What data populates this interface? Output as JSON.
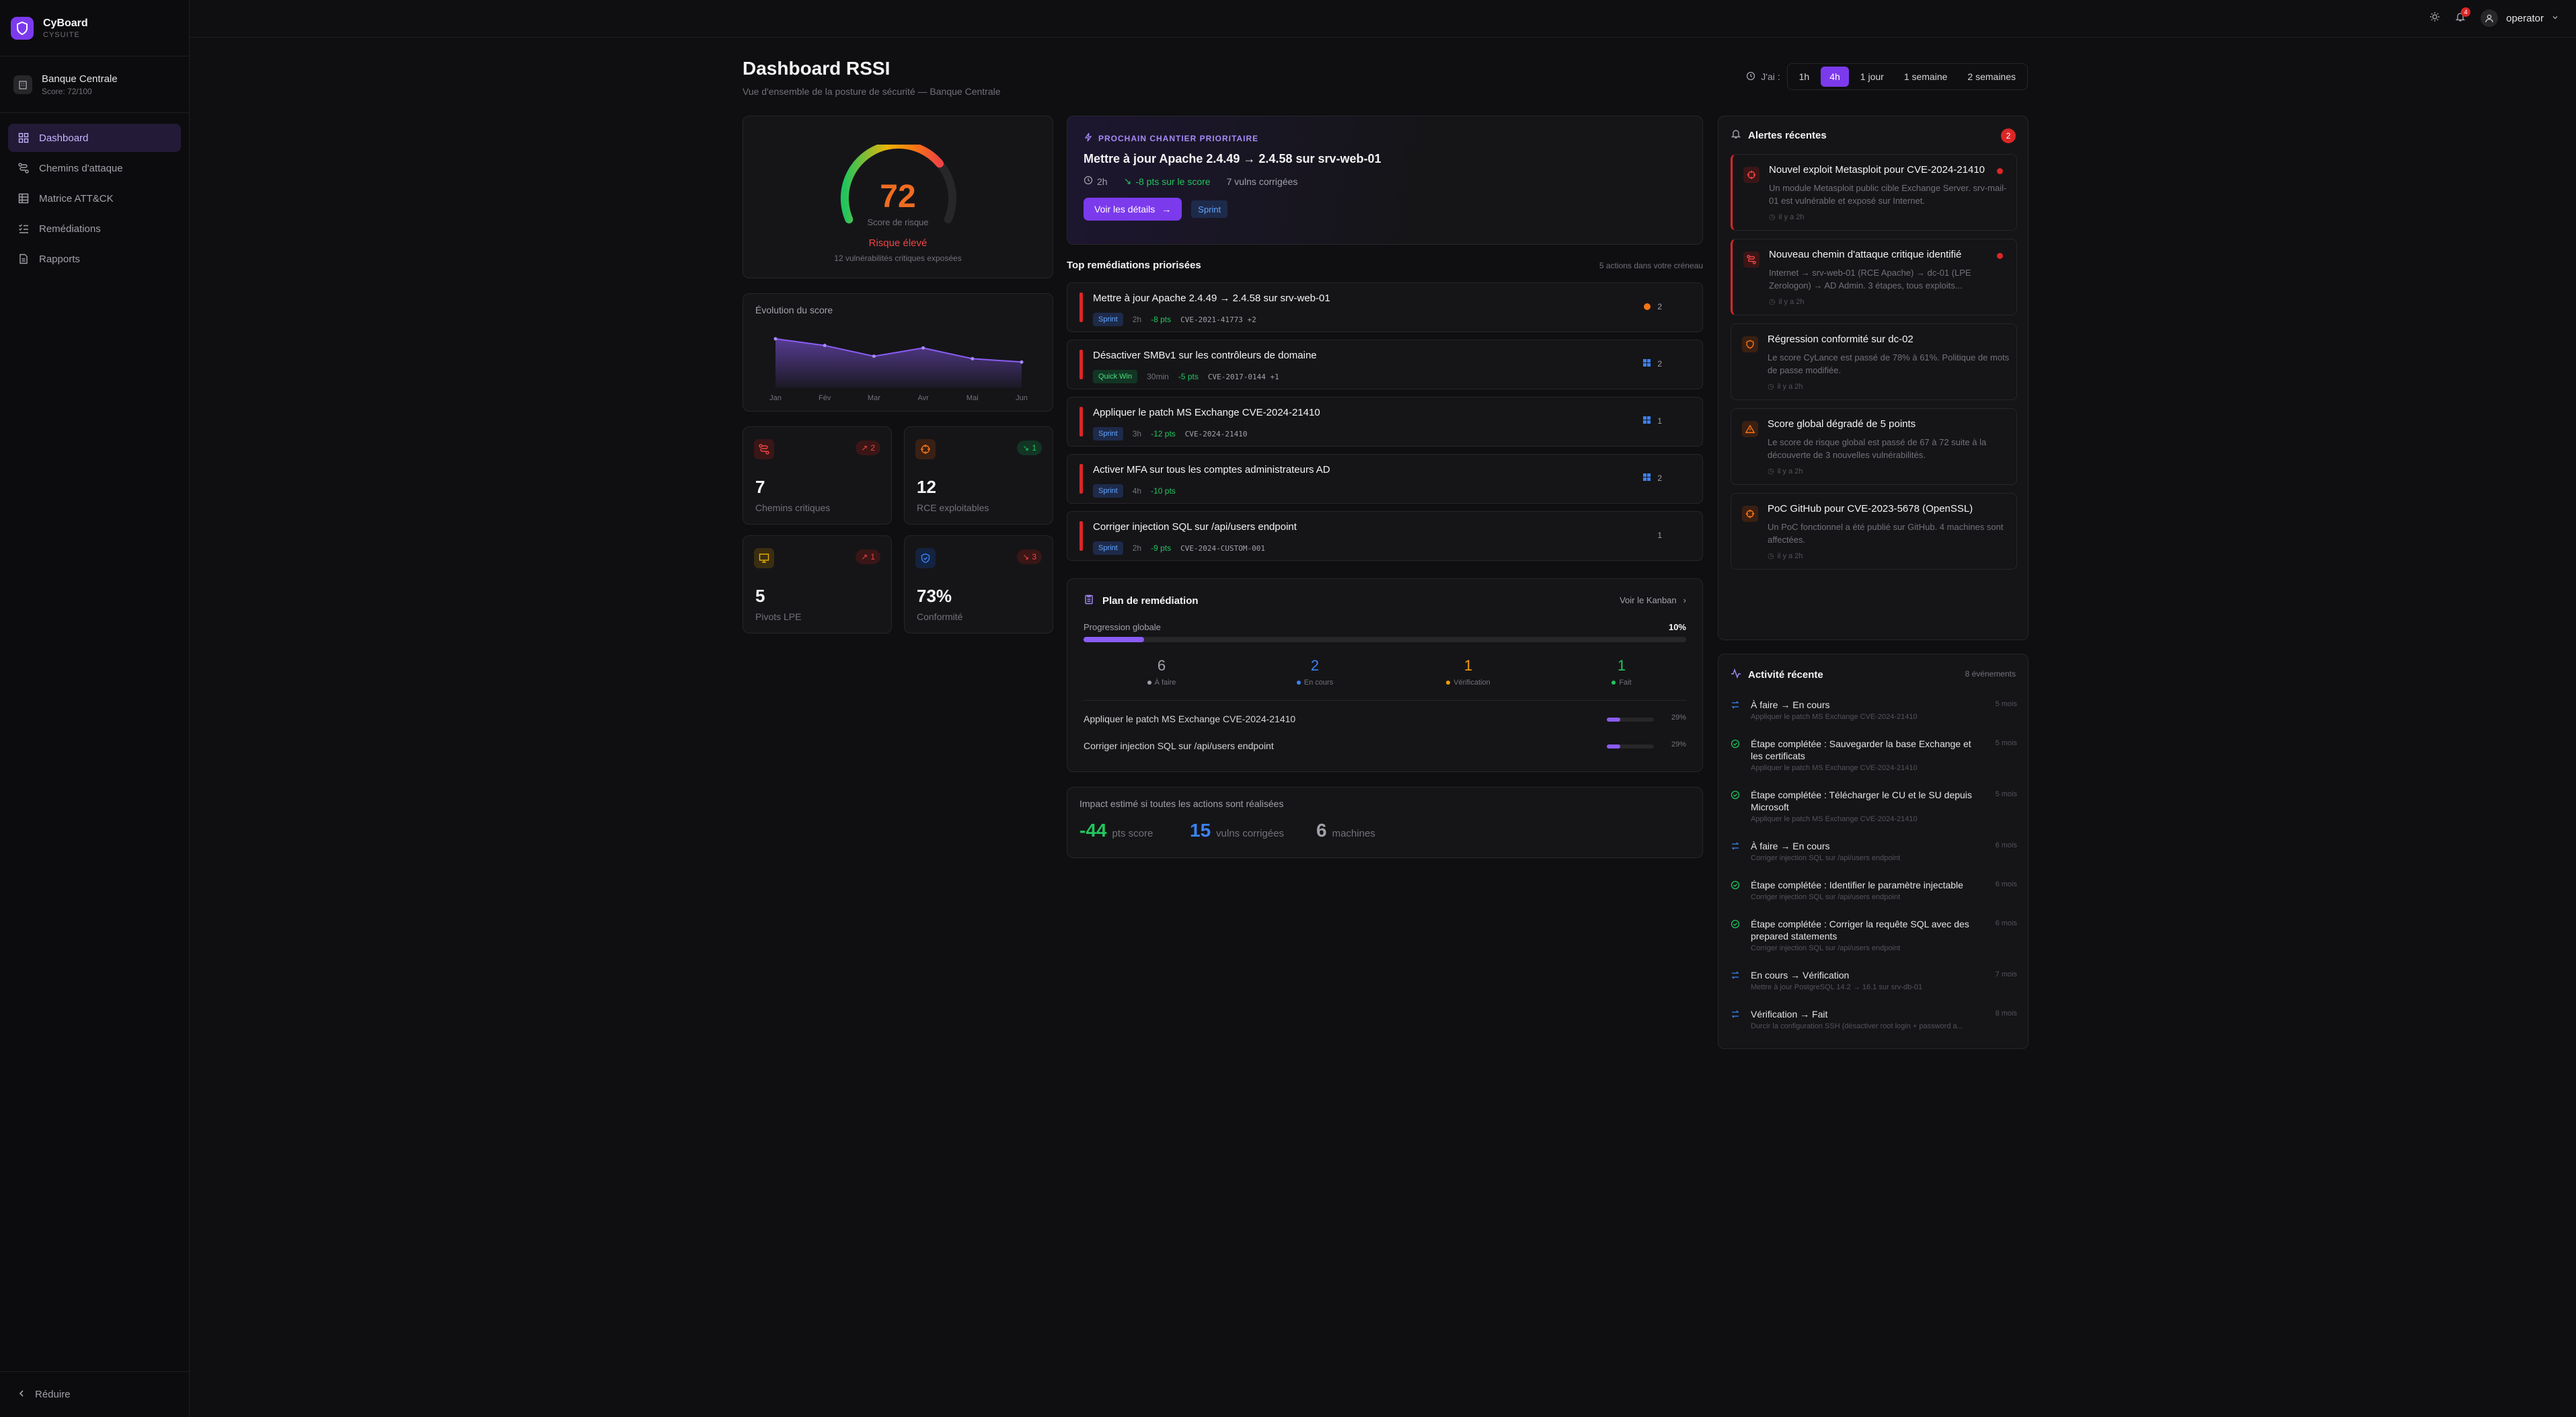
{
  "app": {
    "name": "CyBoard",
    "suite": "CYSUITE"
  },
  "org": {
    "name": "Banque Centrale",
    "score": "Score: 72/100"
  },
  "nav": [
    {
      "label": "Dashboard",
      "icon": "grid-icon"
    },
    {
      "label": "Chemins d'attaque",
      "icon": "route-icon"
    },
    {
      "label": "Matrice ATT&CK",
      "icon": "table-icon"
    },
    {
      "label": "Remédiations",
      "icon": "list-check-icon"
    },
    {
      "label": "Rapports",
      "icon": "document-icon"
    }
  ],
  "collapse_label": "Réduire",
  "topbar": {
    "notification_count": "4",
    "user": "operator"
  },
  "page": {
    "title": "Dashboard RSSI",
    "subtitle": "Vue d'ensemble de la posture de sécurité — Banque Centrale"
  },
  "time_range": {
    "label": "J'ai :",
    "options": [
      "1h",
      "4h",
      "1 jour",
      "1 semaine",
      "2 semaines"
    ],
    "selected": "4h"
  },
  "risk": {
    "score": "72",
    "score_value": 72,
    "caption": "Score de risque",
    "level": "Risque élevé",
    "detail": "12 vulnérabilités critiques exposées"
  },
  "chart_data": {
    "type": "area",
    "title": "Évolution du score",
    "categories": [
      "Jan",
      "Fév",
      "Mar",
      "Avr",
      "Mai",
      "Jun"
    ],
    "values": [
      88,
      80,
      67,
      77,
      64,
      60
    ],
    "ylim": [
      40,
      100
    ]
  },
  "stats": [
    {
      "value": "7",
      "label": "Chemins critiques",
      "badge": "2",
      "trend": "up-bad",
      "icon": "route-icon",
      "color": "#ef4444"
    },
    {
      "value": "12",
      "label": "RCE exploitables",
      "badge": "1",
      "trend": "down-good",
      "icon": "target-icon",
      "color": "#f97316"
    },
    {
      "value": "5",
      "label": "Pivots LPE",
      "badge": "1",
      "trend": "up-bad",
      "icon": "monitor-icon",
      "color": "#eab308"
    },
    {
      "value": "73%",
      "label": "Conformité",
      "badge": "3",
      "trend": "down-bad",
      "icon": "shield-check-icon",
      "color": "#3b82f6"
    }
  ],
  "priority": {
    "eyebrow": "PROCHAIN CHANTIER PRIORITAIRE",
    "title": "Mettre à jour Apache 2.4.49 → 2.4.58 sur srv-web-01",
    "duration": "2h",
    "gain": "-8 pts sur le score",
    "vulns": "7 vulns corrigées",
    "button": "Voir les détails",
    "tag": "Sprint"
  },
  "remediations": {
    "title": "Top remédiations priorisées",
    "note": "5 actions dans votre créneau",
    "items": [
      {
        "title": "Mettre à jour Apache 2.4.49 → 2.4.58 sur srv-web-01",
        "tag": "Sprint",
        "time": "2h",
        "pts": "-8 pts",
        "cve": "CVE-2021-41773 +2",
        "count": "2",
        "dot": "#f97316"
      },
      {
        "title": "Désactiver SMBv1 sur les contrôleurs de domaine",
        "tag": "Quick Win",
        "time": "30min",
        "pts": "-5 pts",
        "cve": "CVE-2017-0144 +1",
        "count": "2",
        "dot": "#3b82f6"
      },
      {
        "title": "Appliquer le patch MS Exchange CVE-2024-21410",
        "tag": "Sprint",
        "time": "3h",
        "pts": "-12 pts",
        "cve": "CVE-2024-21410",
        "count": "1",
        "dot": "#3b82f6"
      },
      {
        "title": "Activer MFA sur tous les comptes administrateurs AD",
        "tag": "Sprint",
        "time": "4h",
        "pts": "-10 pts",
        "cve": "",
        "count": "2",
        "dot": "#3b82f6"
      },
      {
        "title": "Corriger injection SQL sur /api/users endpoint",
        "tag": "Sprint",
        "time": "2h",
        "pts": "-9 pts",
        "cve": "CVE-2024-CUSTOM-001",
        "count": "1",
        "dot": ""
      }
    ]
  },
  "plan": {
    "title": "Plan de remédiation",
    "kanban": "Voir le Kanban",
    "progress_label": "Progression globale",
    "progress": "10%",
    "progress_value": 0.1,
    "columns": [
      {
        "num": "6",
        "label": "À faire",
        "color": "#a1a1aa"
      },
      {
        "num": "2",
        "label": "En cours",
        "color": "#3b82f6"
      },
      {
        "num": "1",
        "label": "Vérification",
        "color": "#f59e0b"
      },
      {
        "num": "1",
        "label": "Fait",
        "color": "#22c55e"
      }
    ],
    "tasks": [
      {
        "title": "Appliquer le patch MS Exchange CVE-2024-21410",
        "pct": "29%",
        "value": 0.29
      },
      {
        "title": "Corriger injection SQL sur /api/users endpoint",
        "pct": "29%",
        "value": 0.29
      }
    ]
  },
  "impact": {
    "title": "Impact estimé si toutes les actions sont réalisées",
    "pts": "-44",
    "pts_unit": "pts score",
    "vulns": "15",
    "vulns_unit": "vulns corrigées",
    "machines": "6",
    "machines_unit": "machines"
  },
  "alerts": {
    "title": "Alertes récentes",
    "count": "2",
    "items": [
      {
        "title": "Nouvel exploit Metasploit pour CVE-2024-21410",
        "desc": "Un module Metasploit public cible Exchange Server. srv-mail-01 est vulnérable et exposé sur Internet.",
        "time": "il y a 2h",
        "critical": true,
        "icon": "target-icon",
        "color": "#ef4444"
      },
      {
        "title": "Nouveau chemin d'attaque critique identifié",
        "desc": "Internet → srv-web-01 (RCE Apache) → dc-01 (LPE Zerologon) → AD Admin. 3 étapes, tous exploits...",
        "time": "il y a 2h",
        "critical": true,
        "icon": "route-icon",
        "color": "#ef4444"
      },
      {
        "title": "Régression conformité sur dc-02",
        "desc": "Le score CyLance est passé de 78% à 61%. Politique de mots de passe modifiée.",
        "time": "il y a 2h",
        "critical": false,
        "icon": "shield-icon",
        "color": "#f97316"
      },
      {
        "title": "Score global dégradé de 5 points",
        "desc": "Le score de risque global est passé de 67 à 72 suite à la découverte de 3 nouvelles vulnérabilités.",
        "time": "il y a 2h",
        "critical": false,
        "icon": "warning-icon",
        "color": "#f97316"
      },
      {
        "title": "PoC GitHub pour CVE-2023-5678 (OpenSSL)",
        "desc": "Un PoC fonctionnel a été publié sur GitHub. 4 machines sont affectées.",
        "time": "il y a 2h",
        "critical": false,
        "icon": "target-icon",
        "color": "#f97316"
      }
    ]
  },
  "activity": {
    "title": "Activité récente",
    "count": "8 événements",
    "items": [
      {
        "title": "À faire → En cours",
        "sub": "Appliquer le patch MS Exchange CVE-2024-21410",
        "time": "5 mois",
        "type": "move"
      },
      {
        "title": "Étape complétée : Sauvegarder la base Exchange et les certificats",
        "sub": "Appliquer le patch MS Exchange CVE-2024-21410",
        "time": "5 mois",
        "type": "done"
      },
      {
        "title": "Étape complétée : Télécharger le CU et le SU depuis Microsoft",
        "sub": "Appliquer le patch MS Exchange CVE-2024-21410",
        "time": "5 mois",
        "type": "done"
      },
      {
        "title": "À faire → En cours",
        "sub": "Corriger injection SQL sur /api/users endpoint",
        "time": "6 mois",
        "type": "move"
      },
      {
        "title": "Étape complétée : Identifier le paramètre injectable",
        "sub": "Corriger injection SQL sur /api/users endpoint",
        "time": "6 mois",
        "type": "done"
      },
      {
        "title": "Étape complétée : Corriger la requête SQL avec des prepared statements",
        "sub": "Corriger injection SQL sur /api/users endpoint",
        "time": "6 mois",
        "type": "done"
      },
      {
        "title": "En cours → Vérification",
        "sub": "Mettre à jour PostgreSQL 14.2 → 16.1 sur srv-db-01",
        "time": "7 mois",
        "type": "move"
      },
      {
        "title": "Vérification → Fait",
        "sub": "Durcir la configuration SSH (désactiver root login + password a...",
        "time": "8 mois",
        "type": "move"
      }
    ]
  }
}
